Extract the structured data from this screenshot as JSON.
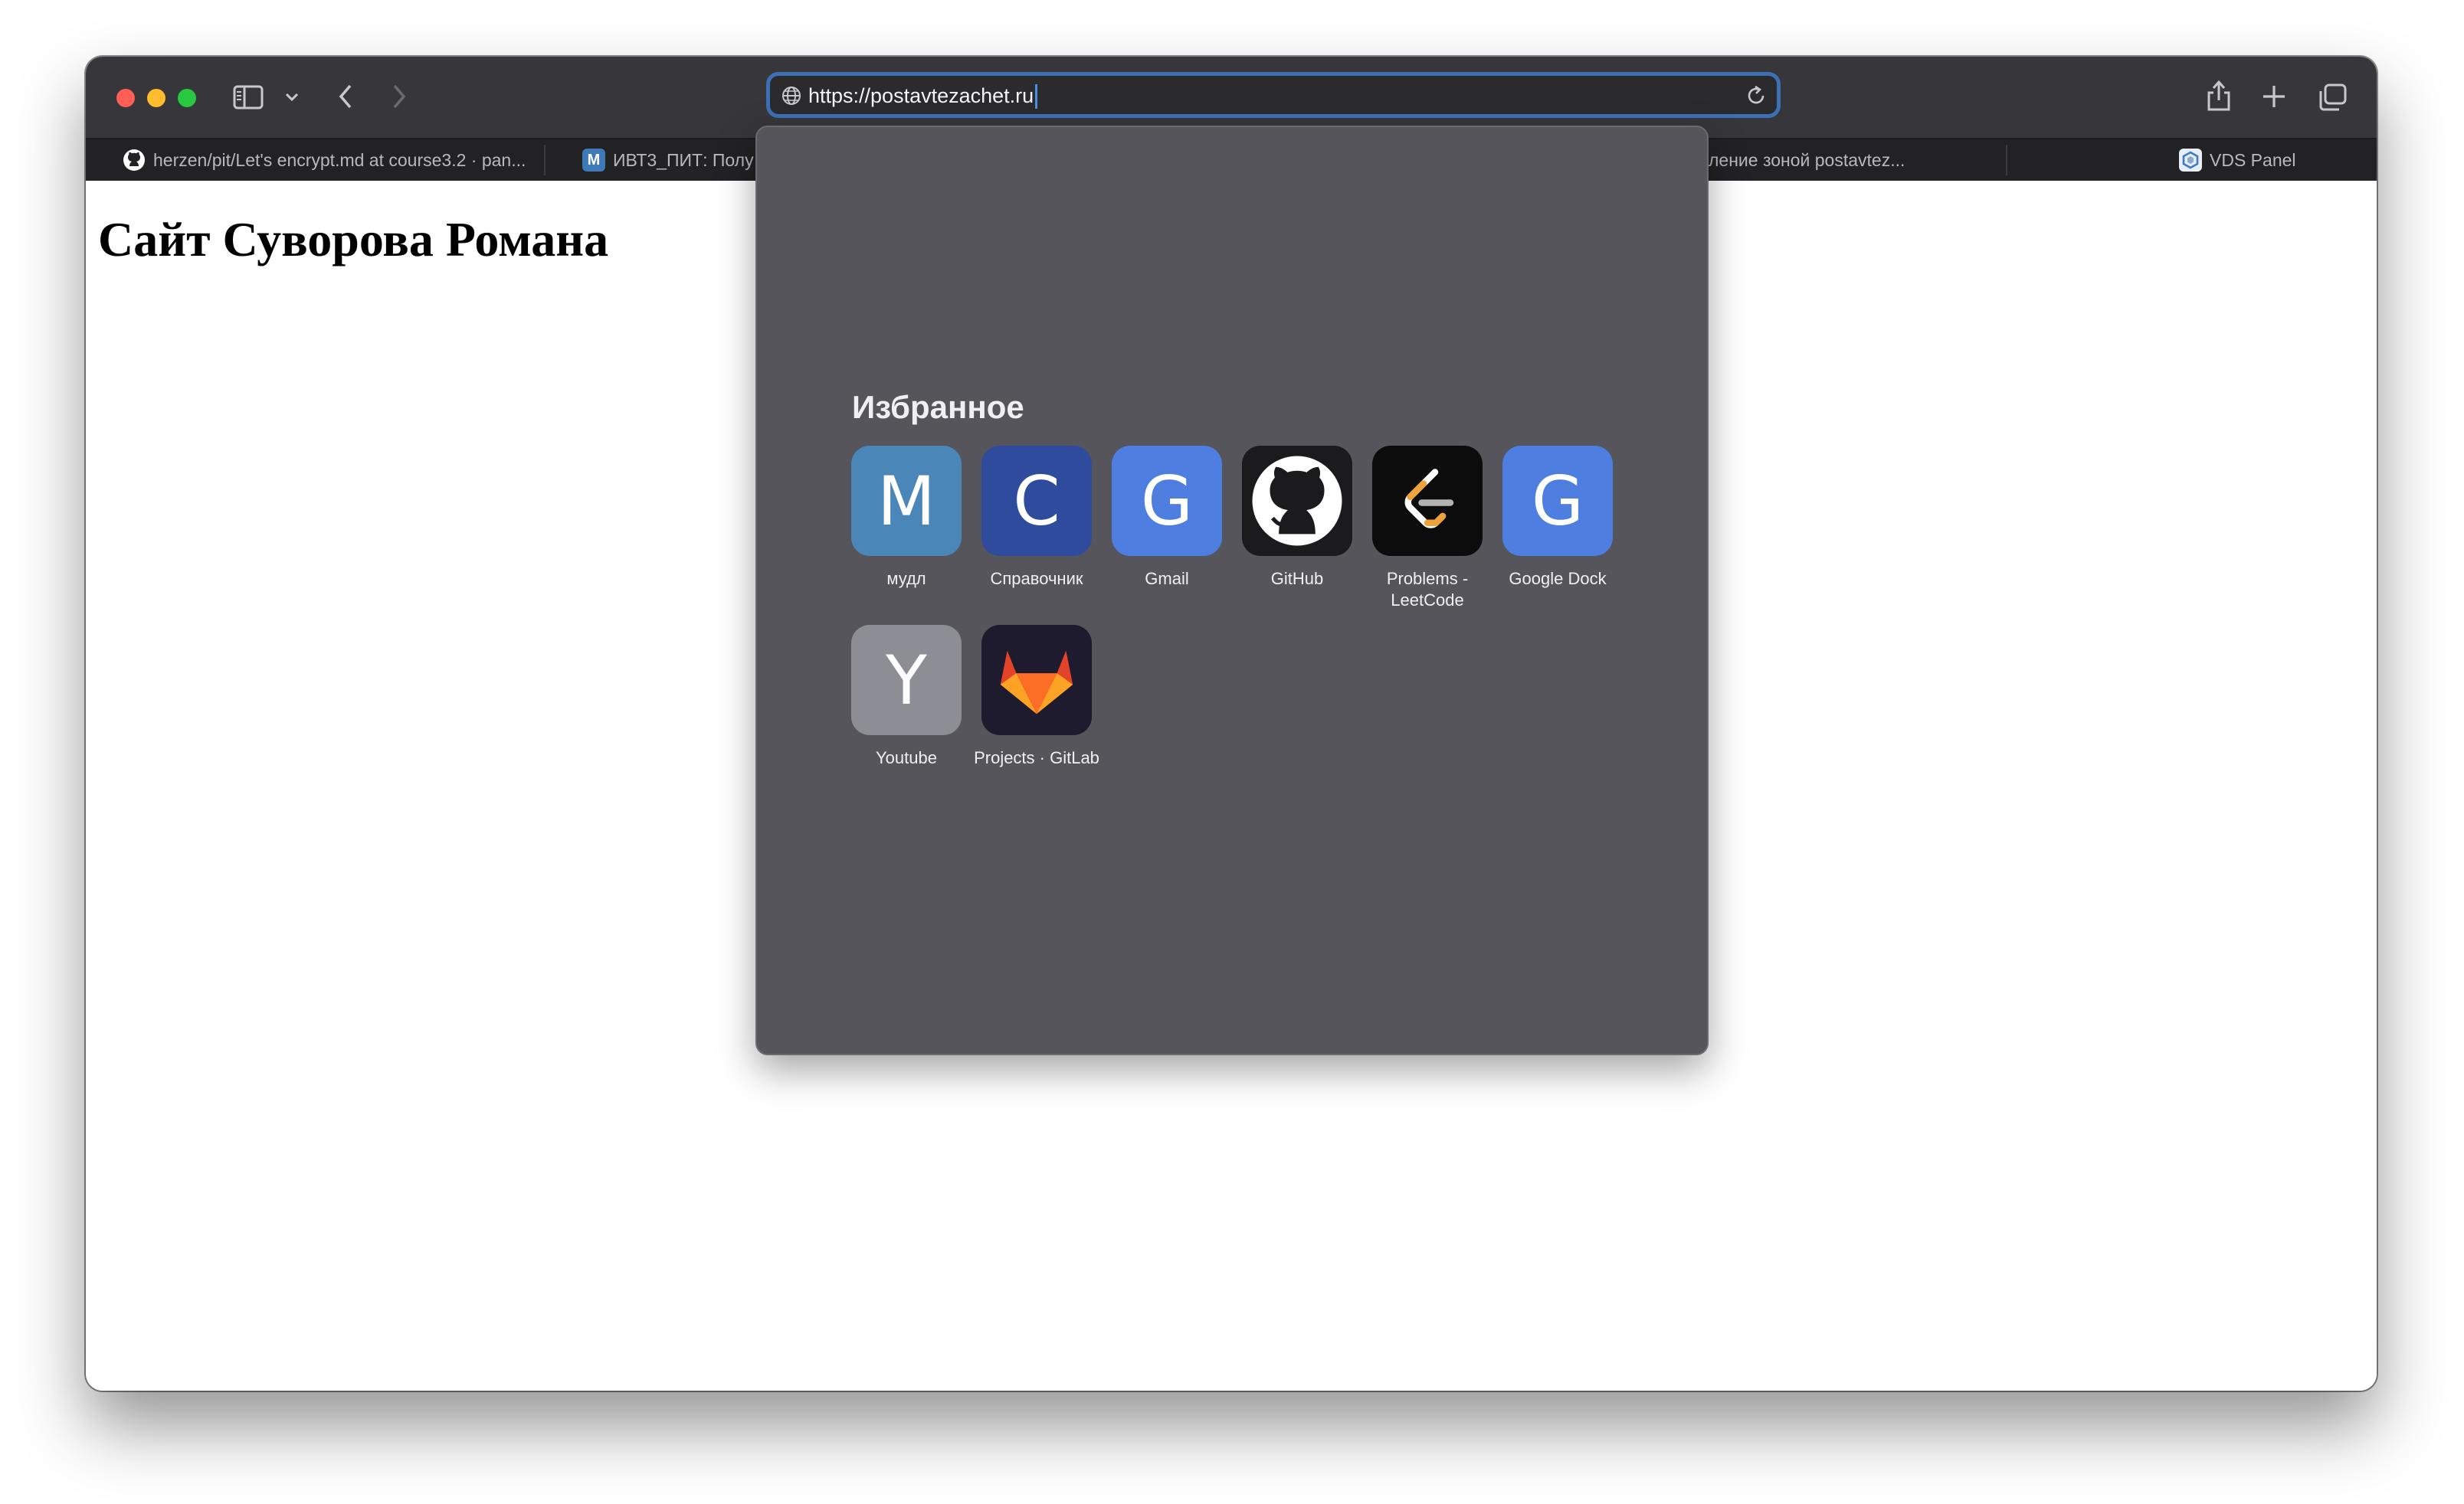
{
  "browser": {
    "url": "https://postavtezachet.ru",
    "colors": {
      "chrome": "#37373b",
      "tabbar": "#222224",
      "url_focus_ring": "#3d6fb5",
      "dropdown": "#55555b"
    }
  },
  "toolbar": {
    "sidebar_icon": "sidebar-icon",
    "back_icon": "chevron-left-icon",
    "forward_icon": "chevron-right-icon",
    "share_icon": "share-icon",
    "new_tab_icon": "plus-icon",
    "tab_overview_icon": "tabs-overview-icon"
  },
  "tabs": [
    {
      "label": "herzen/pit/Let's encrypt.md at course3.2 · pan...",
      "icon": "github-icon"
    },
    {
      "label": "ИВТ3_ПИТ: Полу",
      "icon": "moodle-icon"
    },
    {
      "label": "ление зоной postavtez...",
      "icon": ""
    },
    {
      "label": "VDS Panel",
      "icon": "vds-panel-icon"
    }
  ],
  "page": {
    "heading": "Сайт Суворова Романа"
  },
  "favorites": {
    "title": "Избранное",
    "items": [
      {
        "letter": "M",
        "label": "мудл",
        "color": "#4a87b8"
      },
      {
        "letter": "C",
        "label": "Справочник",
        "color": "#2f4b9e"
      },
      {
        "letter": "G",
        "label": "Gmail",
        "color": "#4e7fe0"
      },
      {
        "icon": "github-icon",
        "label": "GitHub",
        "color": "#1b1b1d"
      },
      {
        "icon": "leetcode-icon",
        "label": "Problems - LeetCode",
        "color": "#0c0c0c"
      },
      {
        "letter": "G",
        "label": "Google Dock",
        "color": "#4e7fe0"
      },
      {
        "letter": "Y",
        "label": "Youtube",
        "color": "#8d8d95"
      },
      {
        "icon": "gitlab-icon",
        "label": "Projects · GitLab",
        "color": "#1f1b2e"
      }
    ]
  }
}
